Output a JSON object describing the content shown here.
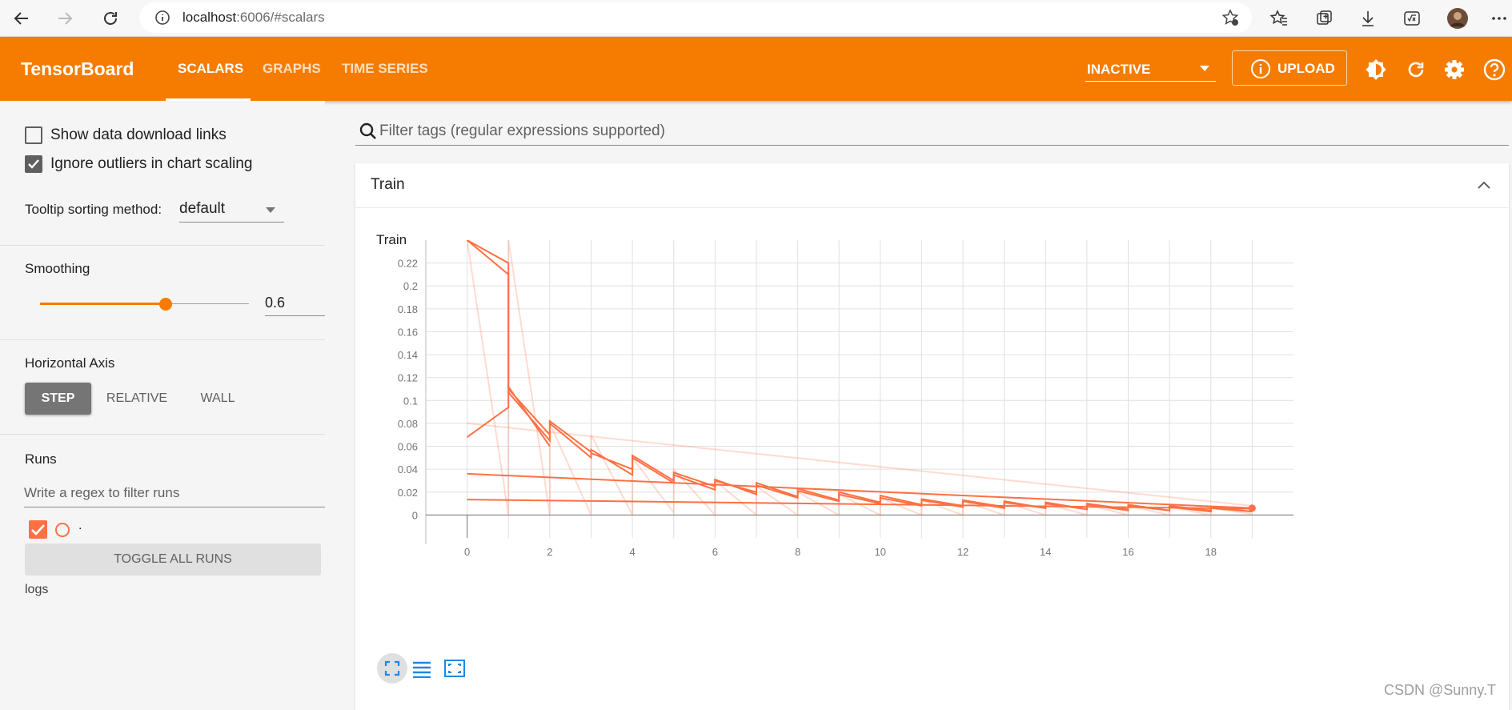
{
  "browser": {
    "url_host": "localhost",
    "url_rest": ":6006/#scalars"
  },
  "header": {
    "title": "TensorBoard",
    "tabs": [
      {
        "label": "SCALARS",
        "active": true
      },
      {
        "label": "GRAPHS",
        "active": false
      },
      {
        "label": "TIME SERIES",
        "active": false
      }
    ],
    "status_select": "INACTIVE",
    "upload_label": "UPLOAD",
    "accent_color": "#f57c00"
  },
  "sidebar": {
    "show_download_links": {
      "label": "Show data download links",
      "checked": false
    },
    "ignore_outliers": {
      "label": "Ignore outliers in chart scaling",
      "checked": true
    },
    "tooltip_sorting": {
      "label": "Tooltip sorting method:",
      "value": "default"
    },
    "smoothing": {
      "label": "Smoothing",
      "value": "0.6"
    },
    "horizontal_axis": {
      "label": "Horizontal Axis",
      "options": [
        "STEP",
        "RELATIVE",
        "WALL"
      ],
      "selected": "STEP"
    },
    "runs": {
      "label": "Runs",
      "filter_placeholder": "Write a regex to filter runs",
      "run_name": ".",
      "toggle_label": "TOGGLE ALL RUNS",
      "dir": "logs"
    }
  },
  "main": {
    "filter_placeholder": "Filter tags (regular expressions supported)",
    "card_title": "Train"
  },
  "watermark": "CSDN @Sunny.T",
  "chart_data": {
    "type": "line",
    "title": "Train",
    "xlabel": "",
    "ylabel": "",
    "x_ticks": [
      "0",
      "2",
      "4",
      "6",
      "8",
      "10",
      "12",
      "14",
      "16",
      "18"
    ],
    "y_ticks": [
      "0",
      "0.02",
      "0.04",
      "0.06",
      "0.08",
      "0.1",
      "0.12",
      "0.14",
      "0.16",
      "0.18",
      "0.2",
      "0.22"
    ],
    "xlim": [
      -1,
      20
    ],
    "ylim": [
      -0.02,
      0.24
    ],
    "grid": true,
    "color": "#ff7043",
    "series": [
      {
        "x": [
          0,
          1,
          1,
          2,
          2,
          3,
          3,
          4,
          4,
          5,
          5,
          6,
          6,
          7,
          7,
          8,
          8,
          9,
          9,
          10,
          10,
          11,
          11,
          12,
          12,
          13,
          13,
          14,
          14,
          15,
          15,
          16,
          16,
          17,
          17,
          18,
          18,
          19
        ],
        "y": [
          0.24,
          0.21,
          0.11,
          0.07,
          0.08,
          0.05,
          0.057,
          0.035,
          0.052,
          0.03,
          0.037,
          0.025,
          0.03,
          0.02,
          0.028,
          0.016,
          0.023,
          0.013,
          0.02,
          0.011,
          0.017,
          0.009,
          0.014,
          0.008,
          0.013,
          0.007,
          0.012,
          0.006,
          0.011,
          0.005,
          0.01,
          0.005,
          0.009,
          0.004,
          0.008,
          0.004,
          0.007,
          0.003
        ]
      },
      {
        "x": [
          0,
          1,
          1,
          2,
          2,
          3,
          3,
          4,
          4,
          5,
          5,
          6,
          6,
          7,
          7,
          8,
          8,
          9,
          9,
          10,
          10,
          11,
          11,
          12,
          12,
          13,
          13,
          14,
          14,
          15,
          15,
          16,
          16,
          17,
          17,
          18,
          18,
          19
        ],
        "y": [
          0.24,
          0.22,
          0.107,
          0.065,
          0.082,
          0.055,
          0.054,
          0.04,
          0.05,
          0.028,
          0.035,
          0.022,
          0.031,
          0.018,
          0.026,
          0.015,
          0.021,
          0.012,
          0.018,
          0.01,
          0.015,
          0.008,
          0.013,
          0.007,
          0.012,
          0.006,
          0.011,
          0.006,
          0.01,
          0.005,
          0.009,
          0.004,
          0.008,
          0.004,
          0.007,
          0.003,
          0.006,
          0.003
        ]
      },
      {
        "x": [
          0,
          1,
          1,
          2
        ],
        "y": [
          0.068,
          0.094,
          0.112,
          0.06
        ]
      },
      {
        "x": [
          0,
          19
        ],
        "y": [
          0.036,
          0.006
        ]
      },
      {
        "x": [
          0,
          19
        ],
        "y": [
          0.0135,
          0.0055
        ]
      }
    ],
    "raw_series_opacity": 0.25,
    "raw_series": [
      {
        "x": [
          0,
          1,
          1,
          2,
          2,
          3,
          3,
          4,
          4,
          5,
          5,
          6,
          6,
          7,
          7,
          8,
          8,
          9,
          9,
          10,
          10,
          11,
          11,
          12,
          12,
          13,
          13,
          14,
          14,
          15,
          15,
          16,
          16,
          17,
          17,
          18,
          18,
          19
        ],
        "y": [
          0.24,
          0.0,
          0.24,
          0.0,
          0.08,
          0.0,
          0.07,
          0.0,
          0.05,
          0.002,
          0.04,
          0.0,
          0.03,
          0.0,
          0.025,
          0.0,
          0.02,
          0.0,
          0.018,
          0.0,
          0.015,
          0.0,
          0.013,
          0.0,
          0.012,
          0.0,
          0.011,
          0.0,
          0.01,
          0.0,
          0.009,
          0.0,
          0.008,
          0.0,
          0.007,
          0.0,
          0.006,
          0.001
        ]
      },
      {
        "x": [
          0,
          19
        ],
        "y": [
          0.08,
          0.008
        ]
      }
    ]
  }
}
